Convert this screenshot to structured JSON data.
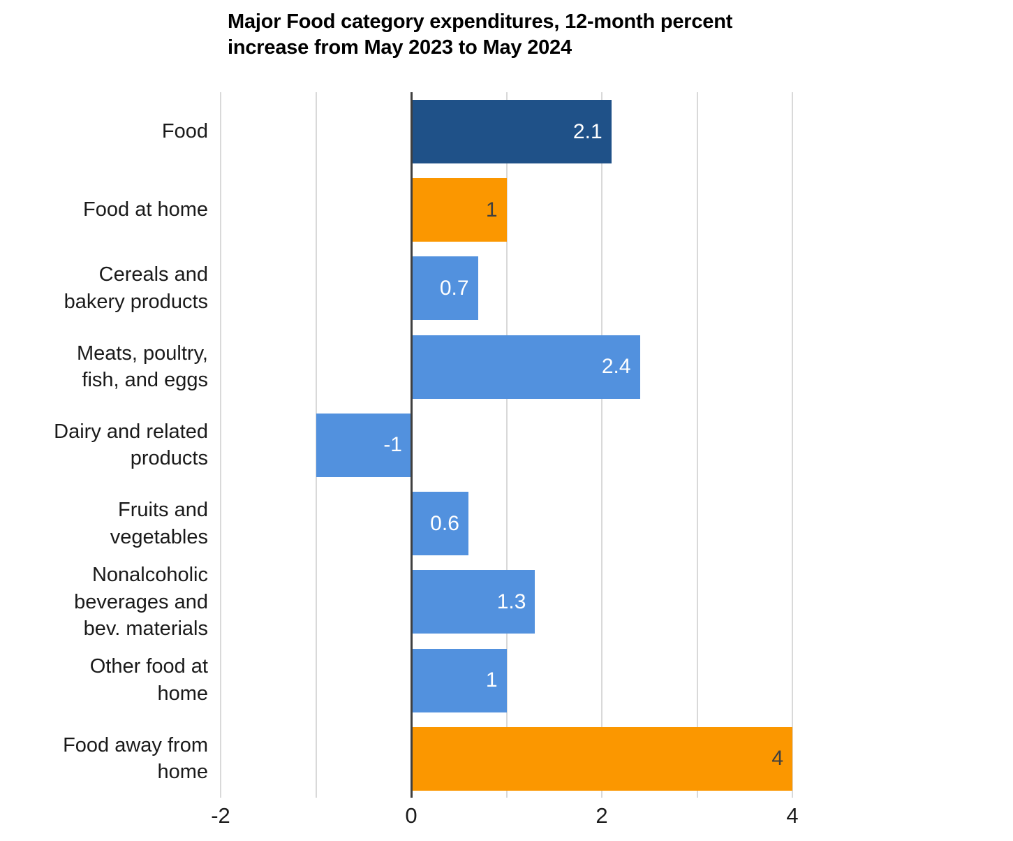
{
  "chart_data": {
    "type": "bar",
    "orientation": "horizontal",
    "title": "Major Food category expenditures, 12-month percent increase from May 2023 to May 2024",
    "title_lines": [
      "Major Food category expenditures, 12-month percent",
      "increase from May 2023 to May 2024"
    ],
    "xlabel": "",
    "ylabel": "",
    "categories": [
      "Food",
      "Food at home",
      "Cereals and bakery products",
      "Meats, poultry, fish, and eggs",
      "Dairy and related products",
      "Fruits and vegetables",
      "Nonalcoholic beverages and bev. materials",
      "Other food at home",
      "Food away from home"
    ],
    "category_label_lines": [
      [
        "Food"
      ],
      [
        "Food at home"
      ],
      [
        "Cereals and",
        "bakery products"
      ],
      [
        "Meats, poultry,",
        "fish, and eggs"
      ],
      [
        "Dairy and related",
        "products"
      ],
      [
        "Fruits and",
        "vegetables"
      ],
      [
        "Nonalcoholic",
        "beverages and",
        "bev. materials"
      ],
      [
        "Other food at",
        "home"
      ],
      [
        "Food away from",
        "home"
      ]
    ],
    "values": [
      2.1,
      1,
      0.7,
      2.4,
      -1,
      0.6,
      1.3,
      1,
      4
    ],
    "value_labels": [
      "2.1",
      "1",
      "0.7",
      "2.4",
      "-1",
      "0.6",
      "1.3",
      "1",
      "4"
    ],
    "bar_colors": [
      "#1F5188",
      "#FB9700",
      "#5291DE",
      "#5291DE",
      "#5291DE",
      "#5291DE",
      "#5291DE",
      "#5291DE",
      "#FB9700"
    ],
    "value_label_colors": [
      "#ffffff",
      "#3f3f3f",
      "#ffffff",
      "#ffffff",
      "#ffffff",
      "#ffffff",
      "#ffffff",
      "#ffffff",
      "#3f3f3f"
    ],
    "xlim": [
      -2,
      4
    ],
    "xticks": [
      -2,
      0,
      2,
      4
    ],
    "xtick_labels": [
      "-2",
      "0",
      "2",
      "4"
    ],
    "gridlines": [
      -2,
      -1,
      0,
      1,
      2,
      3,
      4
    ],
    "grid": true,
    "legend": null,
    "zero_line": 0,
    "colors": {
      "dark_blue": "#1F5188",
      "orange": "#FB9700",
      "light_blue": "#5291DE",
      "gridline": "#d9d9d9",
      "axis_line": "#3f3f3f",
      "text": "#1a1a1a",
      "background": "#ffffff"
    }
  }
}
